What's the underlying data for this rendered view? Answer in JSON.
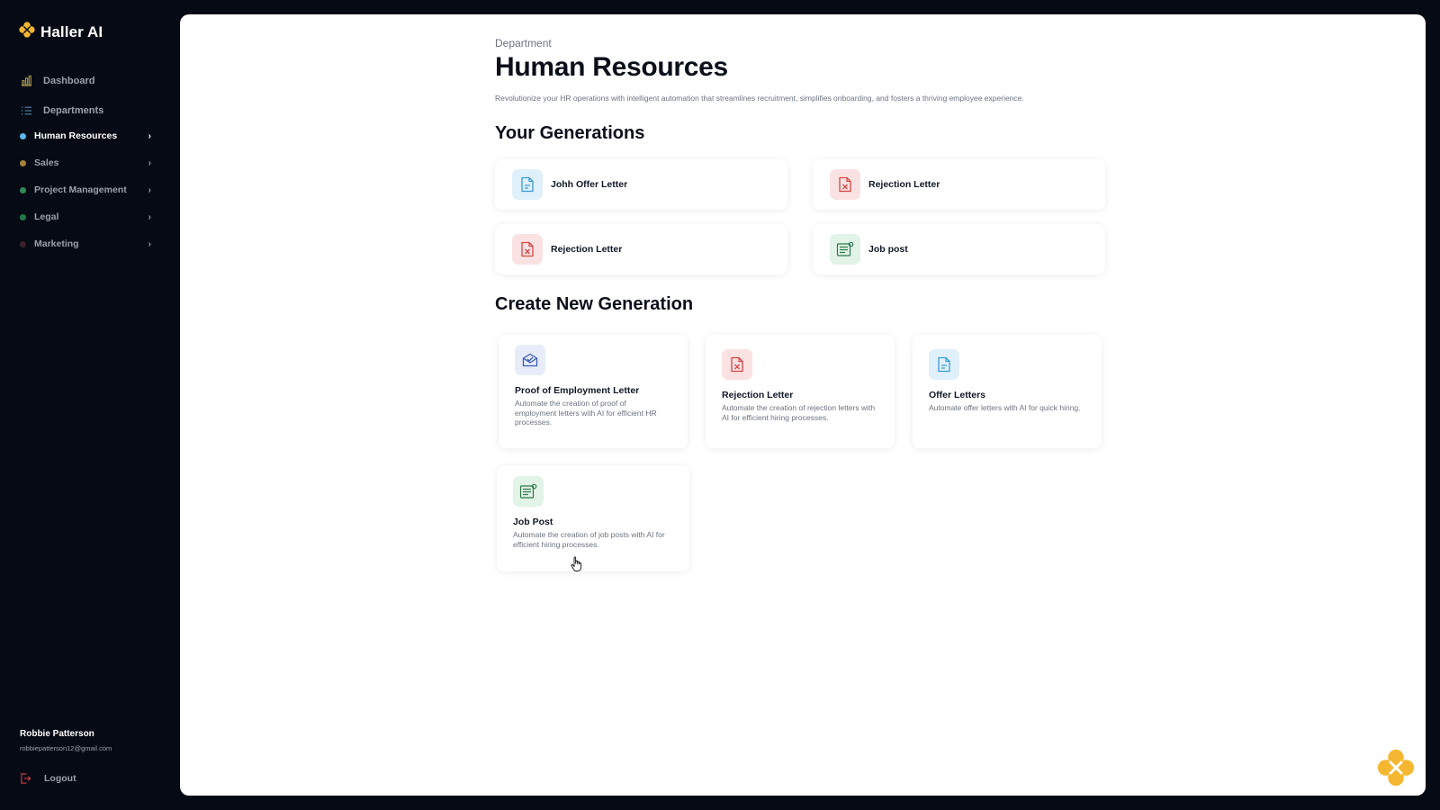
{
  "app": {
    "name": "Haller AI",
    "brand_color": "#f5b731"
  },
  "sidebar": {
    "nav": [
      {
        "label": "Dashboard",
        "icon": "bar-chart-icon"
      },
      {
        "label": "Departments",
        "icon": "list-icon"
      }
    ],
    "departments": [
      {
        "label": "Human Resources",
        "dot_color": "#5bb8f5",
        "active": true
      },
      {
        "label": "Sales",
        "dot_color": "#a7813a",
        "active": false
      },
      {
        "label": "Project Management",
        "dot_color": "#2f8a55",
        "active": false
      },
      {
        "label": "Legal",
        "dot_color": "#1f7a45",
        "active": false
      },
      {
        "label": "Marketing",
        "dot_color": "#3b1f2f",
        "active": false
      }
    ],
    "user": {
      "name": "Robbie Patterson",
      "email": "robbiepatterson12@gmail.com"
    },
    "logout_label": "Logout"
  },
  "main": {
    "breadcrumb": "Department",
    "title": "Human Resources",
    "description": "Revolutionize your HR operations with intelligent automation that streamlines recruitment, simplifies onboarding, and fosters a thriving employee experience.",
    "your_generations": {
      "title": "Your Generations",
      "items": [
        {
          "label": "Johh Offer Letter",
          "icon": "document-icon"
        },
        {
          "label": "Rejection Letter",
          "icon": "rejected-document-icon"
        },
        {
          "label": "Rejection Letter",
          "icon": "rejected-document-icon"
        },
        {
          "label": "Job post",
          "icon": "job-post-icon"
        }
      ]
    },
    "create_new": {
      "title": "Create New Generation",
      "items": [
        {
          "title": "Proof of Employment Letter",
          "description": "Automate the creation of proof of employment letters with AI for efficient HR processes.",
          "icon": "mail-check-icon"
        },
        {
          "title": "Rejection Letter",
          "description": "Automate the creation of rejection letters with AI for efficient hiring processes.",
          "icon": "rejected-document-icon"
        },
        {
          "title": "Offer Letters",
          "description": "Automate offer letters with AI for quick hiring.",
          "icon": "document-icon"
        },
        {
          "title": "Job Post",
          "description": "Automate the creation of job posts with AI for efficient hiring processes.",
          "icon": "job-post-icon"
        }
      ]
    }
  }
}
